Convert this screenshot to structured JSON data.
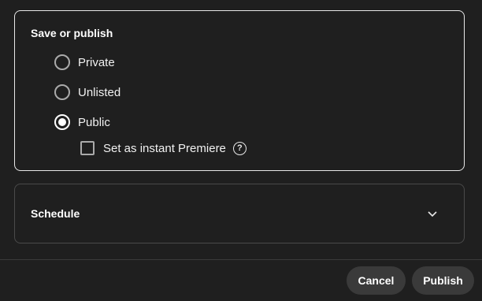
{
  "visibility": {
    "title": "Save or publish",
    "options": [
      {
        "label": "Private",
        "checked": false
      },
      {
        "label": "Unlisted",
        "checked": false
      },
      {
        "label": "Public",
        "checked": true
      }
    ],
    "premiere": {
      "label": "Set as instant Premiere",
      "checked": false,
      "help_icon": "?"
    }
  },
  "schedule": {
    "title": "Schedule",
    "expand_icon": "chevron-down-icon"
  },
  "footer": {
    "cancel_label": "Cancel",
    "publish_label": "Publish"
  },
  "colors": {
    "background": "#1f1f1f",
    "active_border": "#e8e8e8",
    "inactive_border": "#4a4a4a",
    "button_bg": "#3a3a3a"
  }
}
